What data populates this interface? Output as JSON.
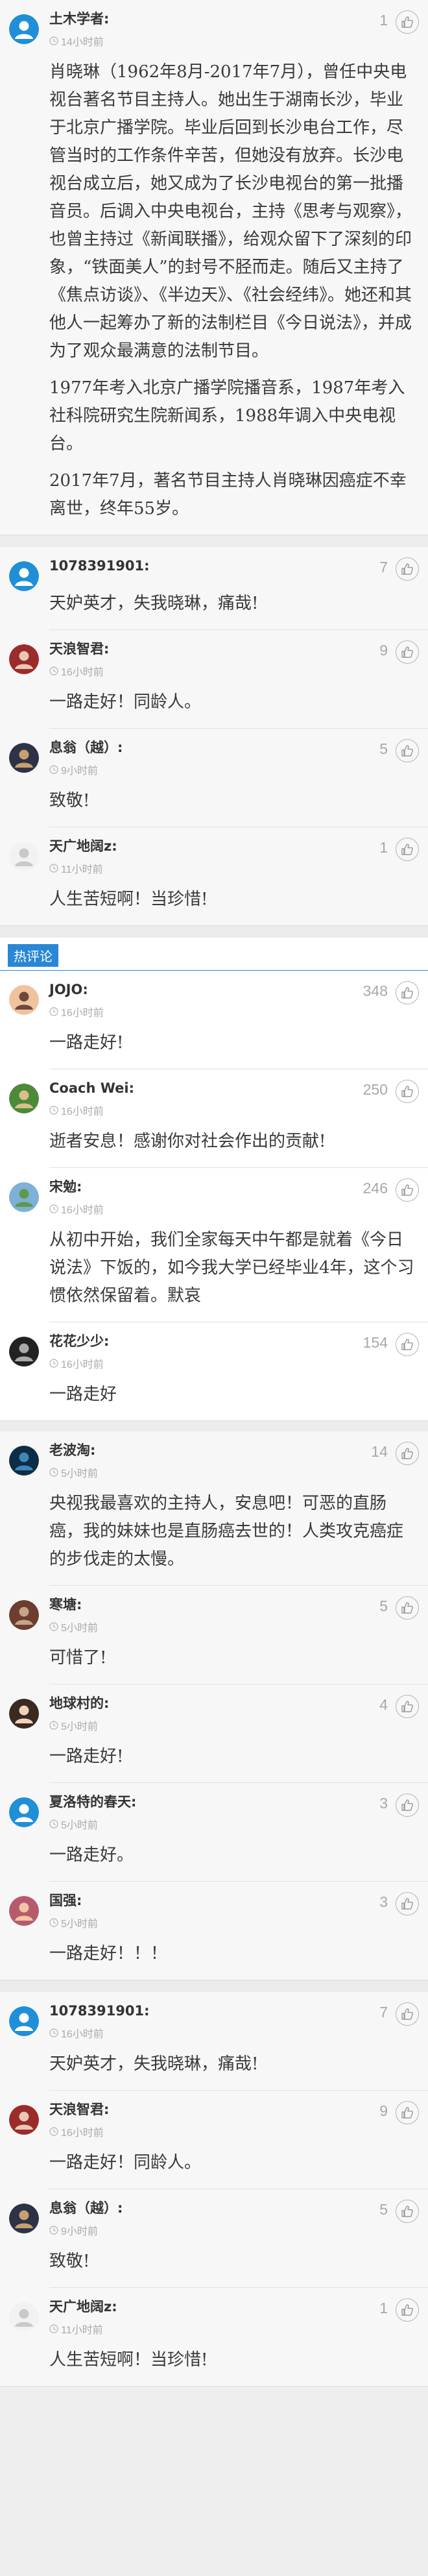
{
  "block1": [
    {
      "name": "土木学者:",
      "time": "14小时前",
      "likes": "1",
      "avatar": "default",
      "paragraphs": [
        "肖晓琳（1962年8月-2017年7月），曾任中央电视台著名节目主持人。她出生于湖南长沙，毕业于北京广播学院。毕业后回到长沙电台工作，尽管当时的工作条件辛苦，但她没有放弃。长沙电视台成立后，她又成为了长沙电视台的第一批播音员。后调入中央电视台，主持《思考与观察》，也曾主持过《新闻联播》，给观众留下了深刻的印象，“铁面美人”的封号不胫而走。随后又主持了《焦点访谈》、《半边天》、《社会经纬》。她还和其他人一起筹办了新的法制栏目《今日说法》，并成为了观众最满意的法制节目。",
        "1977年考入北京广播学院播音系，1987年考入社科院研究生院新闻系，1988年调入中央电视台。",
        "2017年7月，著名节目主持人肖晓琳因癌症不幸离世，终年55岁。"
      ]
    }
  ],
  "block2": [
    {
      "name": "1078391901:",
      "time": "",
      "likes": "7",
      "avatar": "default",
      "text": "天妒英才，失我晓琳，痛哉!"
    },
    {
      "name": "天浪智君:",
      "time": "16小时前",
      "likes": "9",
      "avatar": "red",
      "text": "一路走好！同龄人。"
    },
    {
      "name": "息翁（越）:",
      "time": "9小时前",
      "likes": "5",
      "avatar": "dark",
      "text": "致敬!"
    },
    {
      "name": "天广地阔z:",
      "time": "11小时前",
      "likes": "1",
      "avatar": "white",
      "text": "人生苦短啊！当珍惜!"
    }
  ],
  "hot_label": "热评论",
  "hot": [
    {
      "name": "JOJO:",
      "time": "16小时前",
      "likes": "348",
      "avatar": "cartoon",
      "text": "一路走好!"
    },
    {
      "name": "Coach Wei:",
      "time": "16小时前",
      "likes": "250",
      "avatar": "green",
      "text": "逝者安息！感谢你对社会作出的贡献!"
    },
    {
      "name": "宋勉:",
      "time": "16小时前",
      "likes": "246",
      "avatar": "landscape",
      "text": "从初中开始，我们全家每天中午都是就着《今日说法》下饭的，如今我大学已经毕业4年，这个习惯依然保留着。默哀"
    },
    {
      "name": "花花少少:",
      "time": "16小时前",
      "likes": "154",
      "avatar": "bw",
      "text": "一路走好"
    }
  ],
  "block4": [
    {
      "name": "老波淘:",
      "time": "5小时前",
      "likes": "14",
      "avatar": "space",
      "text": "央视我最喜欢的主持人，安息吧！可恶的直肠癌，我的妹妹也是直肠癌去世的！人类攻克癌症的步伐走的太慢。"
    },
    {
      "name": "寒塘:",
      "time": "5小时前",
      "likes": "5",
      "avatar": "brown",
      "text": "可惜了!"
    },
    {
      "name": "地球村的:",
      "time": "5小时前",
      "likes": "4",
      "avatar": "girl",
      "text": "一路走好!"
    },
    {
      "name": "夏洛特的春天:",
      "time": "5小时前",
      "likes": "3",
      "avatar": "default",
      "text": "一路走好。"
    },
    {
      "name": "国强:",
      "time": "5小时前",
      "likes": "3",
      "avatar": "flower",
      "text": "一路走好！！！"
    }
  ],
  "block5": [
    {
      "name": "1078391901:",
      "time": "16小时前",
      "likes": "7",
      "avatar": "default",
      "text": "天妒英才，失我晓琳，痛哉!"
    },
    {
      "name": "天浪智君:",
      "time": "16小时前",
      "likes": "9",
      "avatar": "red",
      "text": "一路走好！同龄人。"
    },
    {
      "name": "息翁（越）:",
      "time": "9小时前",
      "likes": "5",
      "avatar": "dark",
      "text": "致敬!"
    },
    {
      "name": "天广地阔z:",
      "time": "11小时前",
      "likes": "1",
      "avatar": "white",
      "text": "人生苦短啊！当珍惜!"
    }
  ],
  "colors": {
    "accent": "#2a86d6",
    "default_avatar": "#1f8fd8"
  },
  "icons": {
    "like": "thumbs-up-icon",
    "time": "clock-icon",
    "avatar": "user-avatar"
  }
}
